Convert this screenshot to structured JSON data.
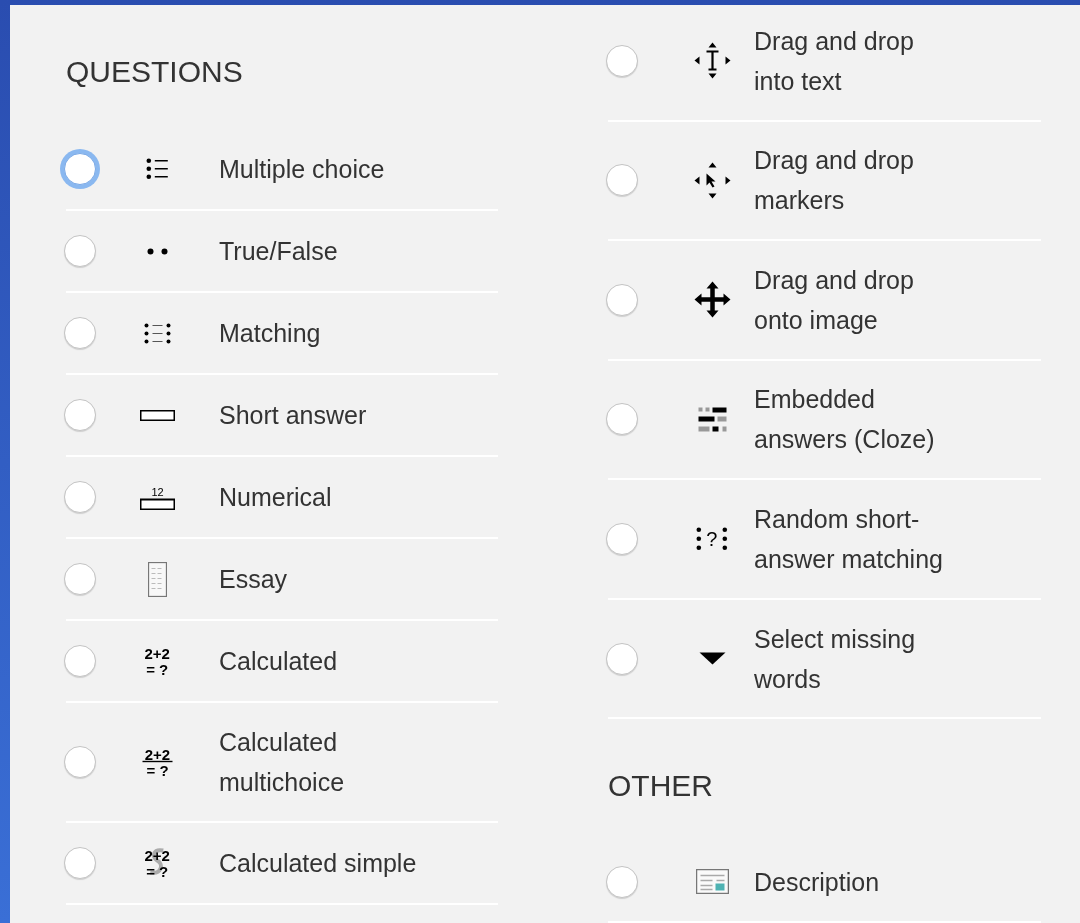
{
  "columns": [
    {
      "blocks": [
        {
          "kind": "heading",
          "text": "QUESTIONS"
        },
        {
          "kind": "option",
          "label": "Multiple choice",
          "selected": false,
          "focused": true
        },
        {
          "kind": "option",
          "label": "True/False",
          "selected": false,
          "focused": false
        },
        {
          "kind": "option",
          "label": "Matching",
          "selected": false,
          "focused": false
        },
        {
          "kind": "option",
          "label": "Short answer",
          "selected": false,
          "focused": false
        },
        {
          "kind": "option",
          "label": "Numerical",
          "icon_text": [
            "12"
          ],
          "selected": false,
          "focused": false
        },
        {
          "kind": "option",
          "label": "Essay",
          "selected": false,
          "focused": false
        },
        {
          "kind": "option",
          "label": "Calculated",
          "icon_text": [
            "2+2",
            "= ?"
          ],
          "selected": false,
          "focused": false
        },
        {
          "kind": "option",
          "label": "Calculated multichoice",
          "icon_text": [
            "2+2",
            "= ?"
          ],
          "selected": false,
          "focused": false
        },
        {
          "kind": "option",
          "label": "Calculated simple",
          "icon_text": [
            "2+2",
            "= ?"
          ],
          "selected": false,
          "focused": false
        }
      ]
    },
    {
      "blocks": [
        {
          "kind": "option",
          "label": "Drag and drop into text",
          "selected": false,
          "focused": false
        },
        {
          "kind": "option",
          "label": "Drag and drop markers",
          "selected": false,
          "focused": false
        },
        {
          "kind": "option",
          "label": "Drag and drop onto image",
          "selected": false,
          "focused": false
        },
        {
          "kind": "option",
          "label": "Embedded answers (Cloze)",
          "selected": false,
          "focused": false
        },
        {
          "kind": "option",
          "label": "Random short-answer matching",
          "icon_text": [
            "?"
          ],
          "selected": false,
          "focused": false
        },
        {
          "kind": "option",
          "label": "Select missing words",
          "selected": false,
          "focused": false
        },
        {
          "kind": "heading",
          "text": "OTHER"
        },
        {
          "kind": "option",
          "label": "Description",
          "selected": false,
          "focused": false
        }
      ]
    }
  ]
}
